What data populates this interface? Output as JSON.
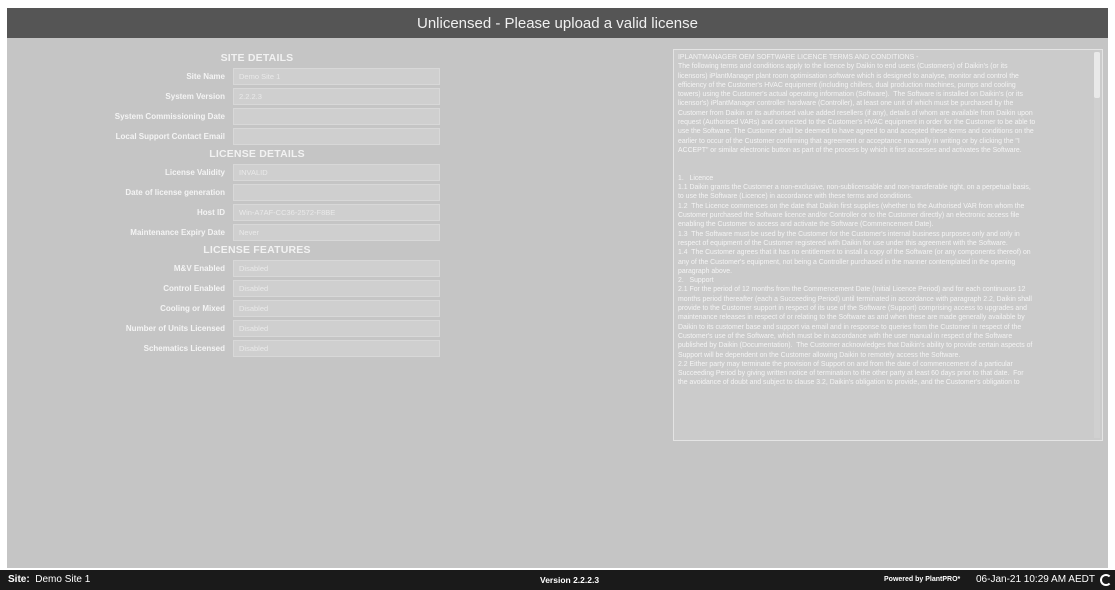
{
  "header": {
    "title": "Unlicensed - Please upload a valid license"
  },
  "site_details": {
    "heading": "SITE DETAILS",
    "rows": [
      {
        "label": "Site Name",
        "value": "Demo Site 1"
      },
      {
        "label": "System Version",
        "value": "2.2.2.3"
      },
      {
        "label": "System Commissioning Date",
        "value": ""
      },
      {
        "label": "Local Support Contact Email",
        "value": ""
      }
    ]
  },
  "license_details": {
    "heading": "LICENSE DETAILS",
    "rows": [
      {
        "label": "License Validity",
        "value": "INVALID"
      },
      {
        "label": "Date of license generation",
        "value": ""
      },
      {
        "label": "Host ID",
        "value": "Win-A7AF-CC36-2572-F8BE"
      },
      {
        "label": "Maintenance Expiry Date",
        "value": "Never"
      }
    ]
  },
  "license_features": {
    "heading": "LICENSE FEATURES",
    "rows": [
      {
        "label": "M&V Enabled",
        "value": "Disabled"
      },
      {
        "label": "Control Enabled",
        "value": "Disabled"
      },
      {
        "label": "Cooling or Mixed",
        "value": "Disabled"
      },
      {
        "label": "Number of Units Licensed",
        "value": "Disabled"
      },
      {
        "label": "Schematics Licensed",
        "value": "Disabled"
      }
    ]
  },
  "terms": {
    "text": "IPLANTMANAGER OEM SOFTWARE LICENCE TERMS AND CONDITIONS -\nThe following terms and conditions apply to the licence by Daikin to end users (Customers) of Daikin's (or its\nlicensors) iPlantManager plant room optimisation software which is designed to analyse, monitor and control the\nefficiency of the Customer's HVAC equipment (including chillers, dual production machines, pumps and cooling\ntowers) using the Customer's actual operating information (Software).  The Software is installed on Daikin's (or its\nlicensor's) iPlantManager controller hardware (Controller), at least one unit of which must be purchased by the\nCustomer from Daikin or its authorised value added resellers (if any), details of whom are available from Daikin upon\nrequest (Authorised VARs) and connected to the Customer's HVAC equipment in order for the Customer to be able to\nuse the Software. The Customer shall be deemed to have agreed to and accepted these terms and conditions on the\nearlier to occur of the Customer confirming that agreement or acceptance manually in writing or by clicking the \"I\nACCEPT\" or similar electronic button as part of the process by which it first accesses and activates the Software.\n\n\n1.   Licence\n1.1 Daikin grants the Customer a non-exclusive, non-sublicensable and non-transferable right, on a perpetual basis,\nto use the Software (Licence) in accordance with these terms and conditions.\n1.2  The Licence commences on the date that Daikin first supplies (whether to the Authorised VAR from whom the\nCustomer purchased the Software licence and/or Controller or to the Customer directly) an electronic access file\nenabling the Customer to access and activate the Software (Commencement Date).\n1.3  The Software must be used by the Customer for the Customer's internal business purposes only and only in\nrespect of equipment of the Customer registered with Daikin for use under this agreement with the Software.\n1.4  The Customer agrees that it has no entitlement to install a copy of the Software (or any components thereof) on\nany of the Customer's equipment, not being a Controller purchased in the manner contemplated in the opening\nparagraph above.\n2.   Support\n2.1 For the period of 12 months from the Commencement Date (Initial Licence Period) and for each continuous 12\nmonths period thereafter (each a Succeeding Period) until terminated in accordance with paragraph 2.2, Daikin shall\nprovide to the Customer support in respect of its use of the Software (Support) comprising access to upgrades and\nmaintenance releases in respect of or relating to the Software as and when these are made generally available by\nDaikin to its customer base and support via email and in response to queries from the Customer in respect of the\nCustomer's use of the Software, which must be in accordance with the user manual in respect of the Software\npublished by Daikin (Documentation).  The Customer acknowledges that Daikin's ability to provide certain aspects of\nSupport will be dependent on the Customer allowing Daikin to remotely access the Software.\n2.2 Either party may terminate the provision of Support on and from the date of commencement of a particular\nSucceeding Period by giving written notice of termination to the other party at least 60 days prior to that date.  For\nthe avoidance of doubt and subject to clause 3.2, Daikin's obligation to provide, and the Customer's obligation to"
  },
  "footer": {
    "site_label": "Site:",
    "site_name": "Demo Site 1",
    "version": "Version 2.2.2.3",
    "powered_by": "Powered by PlantPRO*",
    "datetime": "06-Jan-21 10:29 AM AEDT",
    "refresh_icon": "refresh-icon"
  }
}
